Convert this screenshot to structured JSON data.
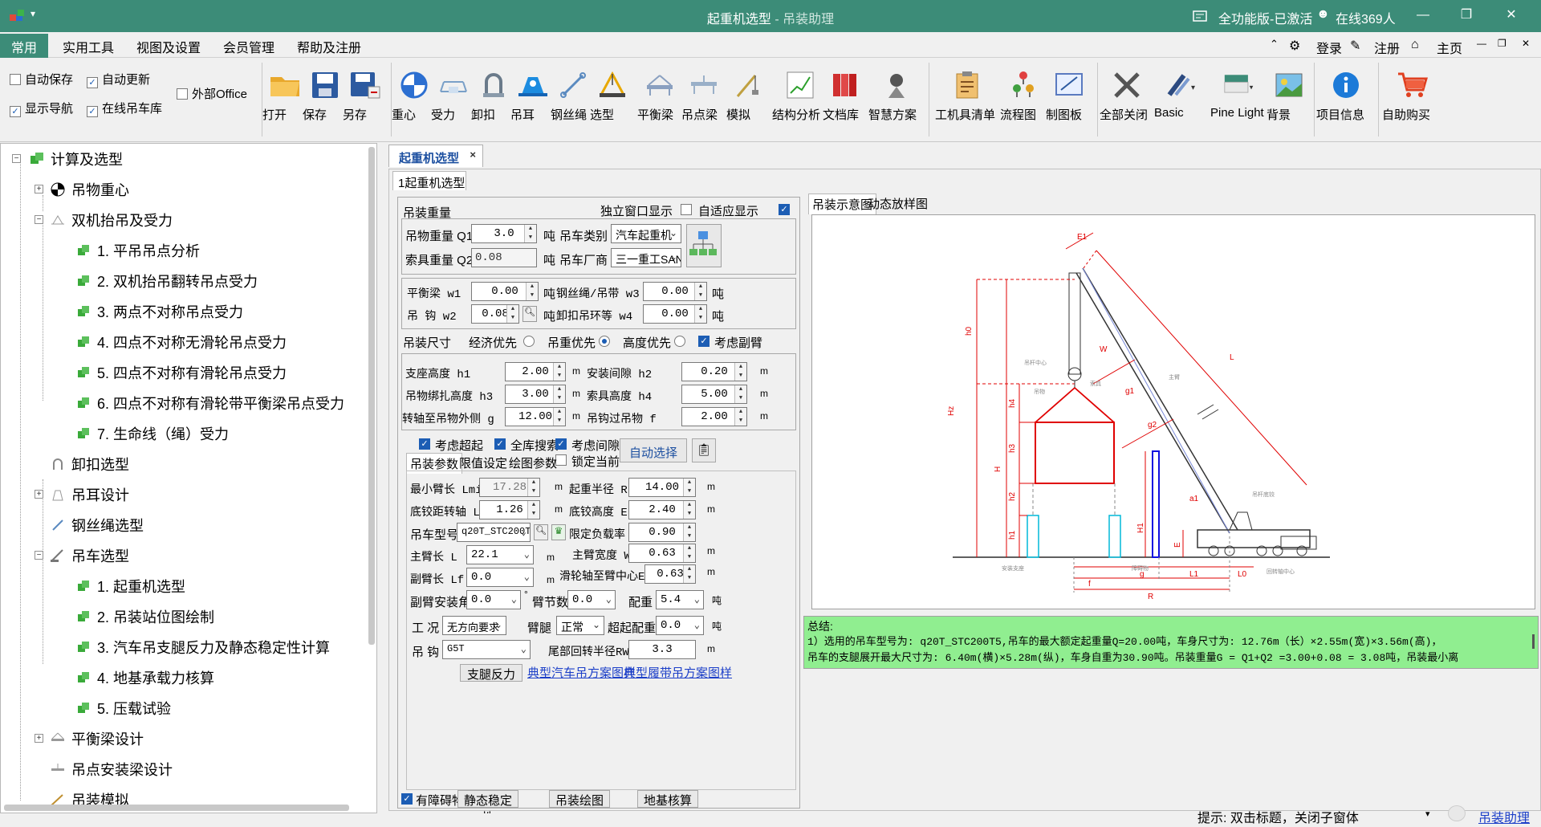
{
  "titlebar": {
    "title": "起重机选型",
    "subtitle": " - 吊装助理",
    "version": "全功能版-已激活",
    "online": "在线369人"
  },
  "menubar": {
    "tabs": [
      "常用",
      "实用工具",
      "视图及设置",
      "会员管理",
      "帮助及注册"
    ],
    "login": "登录",
    "register": "注册",
    "home": "主页"
  },
  "ribbon": {
    "checks": [
      {
        "label": "自动保存",
        "checked": false
      },
      {
        "label": "自动更新",
        "checked": true
      },
      {
        "label": "外部Office",
        "checked": false
      },
      {
        "label": "显示导航",
        "checked": true
      },
      {
        "label": "在线吊车库",
        "checked": true
      }
    ],
    "buttons": [
      "打开",
      "保存",
      "另存",
      "重心",
      "受力",
      "卸扣",
      "吊耳",
      "钢丝绳",
      "选型",
      "平衡梁",
      "吊点梁",
      "模拟",
      "结构分析",
      "文档库",
      "智慧方案",
      "工机具清单",
      "流程图",
      "制图板",
      "全部关闭",
      "Basic",
      "Pine Light",
      "背景",
      "项目信息",
      "自助购买"
    ]
  },
  "tree": {
    "items": [
      {
        "label": "计算及选型"
      },
      {
        "label": "吊物重心"
      },
      {
        "label": "双机抬吊及受力"
      },
      {
        "label": "1. 平吊吊点分析"
      },
      {
        "label": "2. 双机抬吊翻转吊点受力"
      },
      {
        "label": "3. 两点不对称吊点受力"
      },
      {
        "label": "4. 四点不对称无滑轮吊点受力"
      },
      {
        "label": "5. 四点不对称有滑轮吊点受力"
      },
      {
        "label": "6. 四点不对称有滑轮带平衡梁吊点受力"
      },
      {
        "label": "7. 生命线（绳）受力"
      },
      {
        "label": "卸扣选型"
      },
      {
        "label": "吊耳设计"
      },
      {
        "label": "钢丝绳选型"
      },
      {
        "label": "吊车选型"
      },
      {
        "label": "1. 起重机选型"
      },
      {
        "label": "2. 吊装站位图绘制"
      },
      {
        "label": "3. 汽车吊支腿反力及静态稳定性计算"
      },
      {
        "label": "4. 地基承载力核算"
      },
      {
        "label": "5. 压载试验"
      },
      {
        "label": "平衡梁设计"
      },
      {
        "label": "吊点安装梁设计"
      },
      {
        "label": "吊装模拟"
      }
    ]
  },
  "doc": {
    "tab": "起重机选型",
    "close": "×",
    "subtab": "1起重机选型"
  },
  "form": {
    "group_weight": "吊装重量",
    "independent_window": "独立窗口显示",
    "adaptive": "自适应显示",
    "q1_label": "吊物重量 Q1",
    "q1": "3.0",
    "q2_label": "索具重量 Q2",
    "q2": "0.08",
    "unit_t": "吨",
    "crane_type_label": "吊车类别",
    "crane_type": "汽车起重机",
    "maker_label": "吊车厂商",
    "maker": "三一重工SAN",
    "w1_label": "平衡梁 w1",
    "w1": "0.00",
    "w2_label": "吊 钩 w2",
    "w2": "0.08",
    "w3_label": "钢丝绳/吊带 w3",
    "w3": "0.00",
    "w4_label": "卸扣吊环等 w4",
    "w4": "0.00",
    "group_size": "吊装尺寸",
    "opt_econ": "经济优先",
    "opt_weight": "吊重优先",
    "opt_height": "高度优先",
    "consider_jib": "考虑副臂",
    "h1_label": "支座高度 h1",
    "h1": "2.00",
    "h2_label": "安装间隙 h2",
    "h2": "0.20",
    "h3_label": "吊物绑扎高度 h3",
    "h3": "3.00",
    "h4_label": "索具高度 h4",
    "h4": "5.00",
    "g_label": "转轴至吊物外侧 g",
    "g": "12.00",
    "f_label": "吊钩过吊物 f",
    "f": "2.00",
    "unit_m": "m",
    "consider_superlift": "考虑超起",
    "full_search": "全库搜索",
    "consider_gap": "考虑间隙",
    "lock_current": "锁定当前",
    "auto_select": "自动选择",
    "tab_params": "吊装参数",
    "tab_limits": "限值设定",
    "tab_drawing": "绘图参数",
    "lmin_label": "最小臂长 Lmin",
    "lmin": "17.28",
    "r_label": "起重半径 R",
    "r": "14.00",
    "l0_label": "底铰距转轴 L0",
    "l0": "1.26",
    "e_label": "底铰高度 E",
    "e": "2.40",
    "model_label": "吊车型号",
    "model": "q20T_STC200T",
    "rate_label": "限定负载率 e",
    "rate": "0.90",
    "l_label": "主臂长 L",
    "l": "22.1",
    "w_label": "主臂宽度 W",
    "w": "0.63",
    "lf_label": "副臂长 Lf",
    "lf": "0.0",
    "e1_label": "滑轮轴至臂中心E1",
    "e1": "0.63",
    "angle_label": "副臂安装角",
    "angle": "0.0",
    "deg": "°",
    "sections_label": "臂节数",
    "sections": "0.0",
    "counterweight_label": "配重",
    "counterweight": "5.4",
    "condition_label": "工 况",
    "condition": "无方向要求",
    "outrigger_label": "臂腿",
    "outrigger": "正常",
    "superlift_label": "超起配重",
    "superlift": "0.0",
    "hook_label": "吊 钩",
    "hook": "G5T",
    "rw_label": "尾部回转半径RW",
    "rw": "3.3",
    "support_force": "支腿反力",
    "link_truck": "典型汽车吊方案图样",
    "link_crawler": "典型履带吊方案图样",
    "has_obstacle": "有障碍物",
    "static_stability": "静态稳定性",
    "crane_drawing": "吊装绘图",
    "foundation": "地基核算"
  },
  "viewer": {
    "tab1": "吊装示意图",
    "tab2": "动态放样图",
    "labels": {
      "h0": "h0",
      "hz": "Hz",
      "h": "H",
      "h1": "h1",
      "h2": "h2",
      "h3": "h3",
      "h4": "h4",
      "H1": "H1",
      "E": "E",
      "E1": "E1",
      "W": "W",
      "g1": "g1",
      "g2": "g2",
      "a1": "a1",
      "L": "L",
      "f": "f",
      "g": "g",
      "R": "R",
      "L1": "L1",
      "L0": "L0",
      "lbl_center": "吊杆中心",
      "lbl_load": "吊物",
      "lbl_rig": "索具",
      "lbl_boom": "主臂",
      "lbl_hinge": "吊杆底铰",
      "lbl_support": "安装支座",
      "lbl_obstacle": "障碍物",
      "lbl_axis": "回转轴中心"
    }
  },
  "summary": {
    "title": "总结:",
    "line1": "  1）选用的吊车型号为: q20T_STC200T5,吊车的最大额定起重量Q=20.00吨，车身尺寸为: 12.76m（长）×2.55m(宽)×3.56m(高)，",
    "line2": "吊车的支腿展开最大尺寸为: 6.40m(横)×5.28m(纵)，车身自重为30.90吨。吊装重量G = Q1+Q2 =3.00+0.08 = 3.08吨，吊装最小离"
  },
  "statusbar": {
    "hint": "提示: 双击标题，关闭子窗体",
    "helper": "吊装助理"
  },
  "colors": {
    "titlebar": "#3c8c78",
    "summary": "#90ee90",
    "link": "#1c3fc8"
  }
}
